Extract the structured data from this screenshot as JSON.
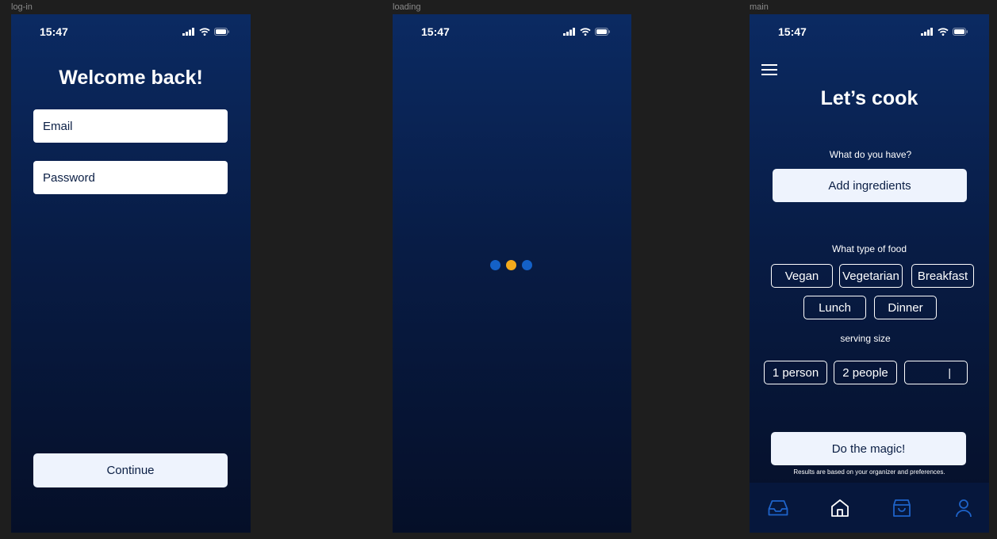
{
  "frames": {
    "login": "log-in",
    "loading": "loading",
    "main": "main"
  },
  "status": {
    "time": "15:47"
  },
  "login": {
    "title": "Welcome back!",
    "email_placeholder": "Email",
    "password_placeholder": "Password",
    "continue_label": "Continue"
  },
  "loading": {
    "dot_colors": [
      "#1461c7",
      "#f4aa1c",
      "#1461c7"
    ]
  },
  "main": {
    "title": "Let’s cook",
    "have_label": "What do you have?",
    "add_ingredients_label": "Add ingredients",
    "food_type_label": "What type of food",
    "food_types": [
      "Vegan",
      "Vegetarian",
      "Breakfast",
      "Lunch",
      "Dinner"
    ],
    "serving_label": "serving size",
    "serving_options": [
      "1 person",
      "2 people"
    ],
    "custom_serving_value": "|",
    "magic_label": "Do the magic!",
    "disclaimer": "Results are based on your organizer and preferences.",
    "nav": [
      {
        "icon": "inbox-icon",
        "active": false
      },
      {
        "icon": "home-icon",
        "active": true
      },
      {
        "icon": "shopping-bag-icon",
        "active": false
      },
      {
        "icon": "profile-icon",
        "active": false
      }
    ]
  },
  "colors": {
    "background": "#1e1e1e",
    "phone_top": "#0b2a62",
    "phone_bottom": "#050f28",
    "button_bg": "#eef3fd",
    "text_dark": "#0a1e44",
    "nav_inactive": "#1e63c9",
    "nav_active": "#ffffff"
  }
}
